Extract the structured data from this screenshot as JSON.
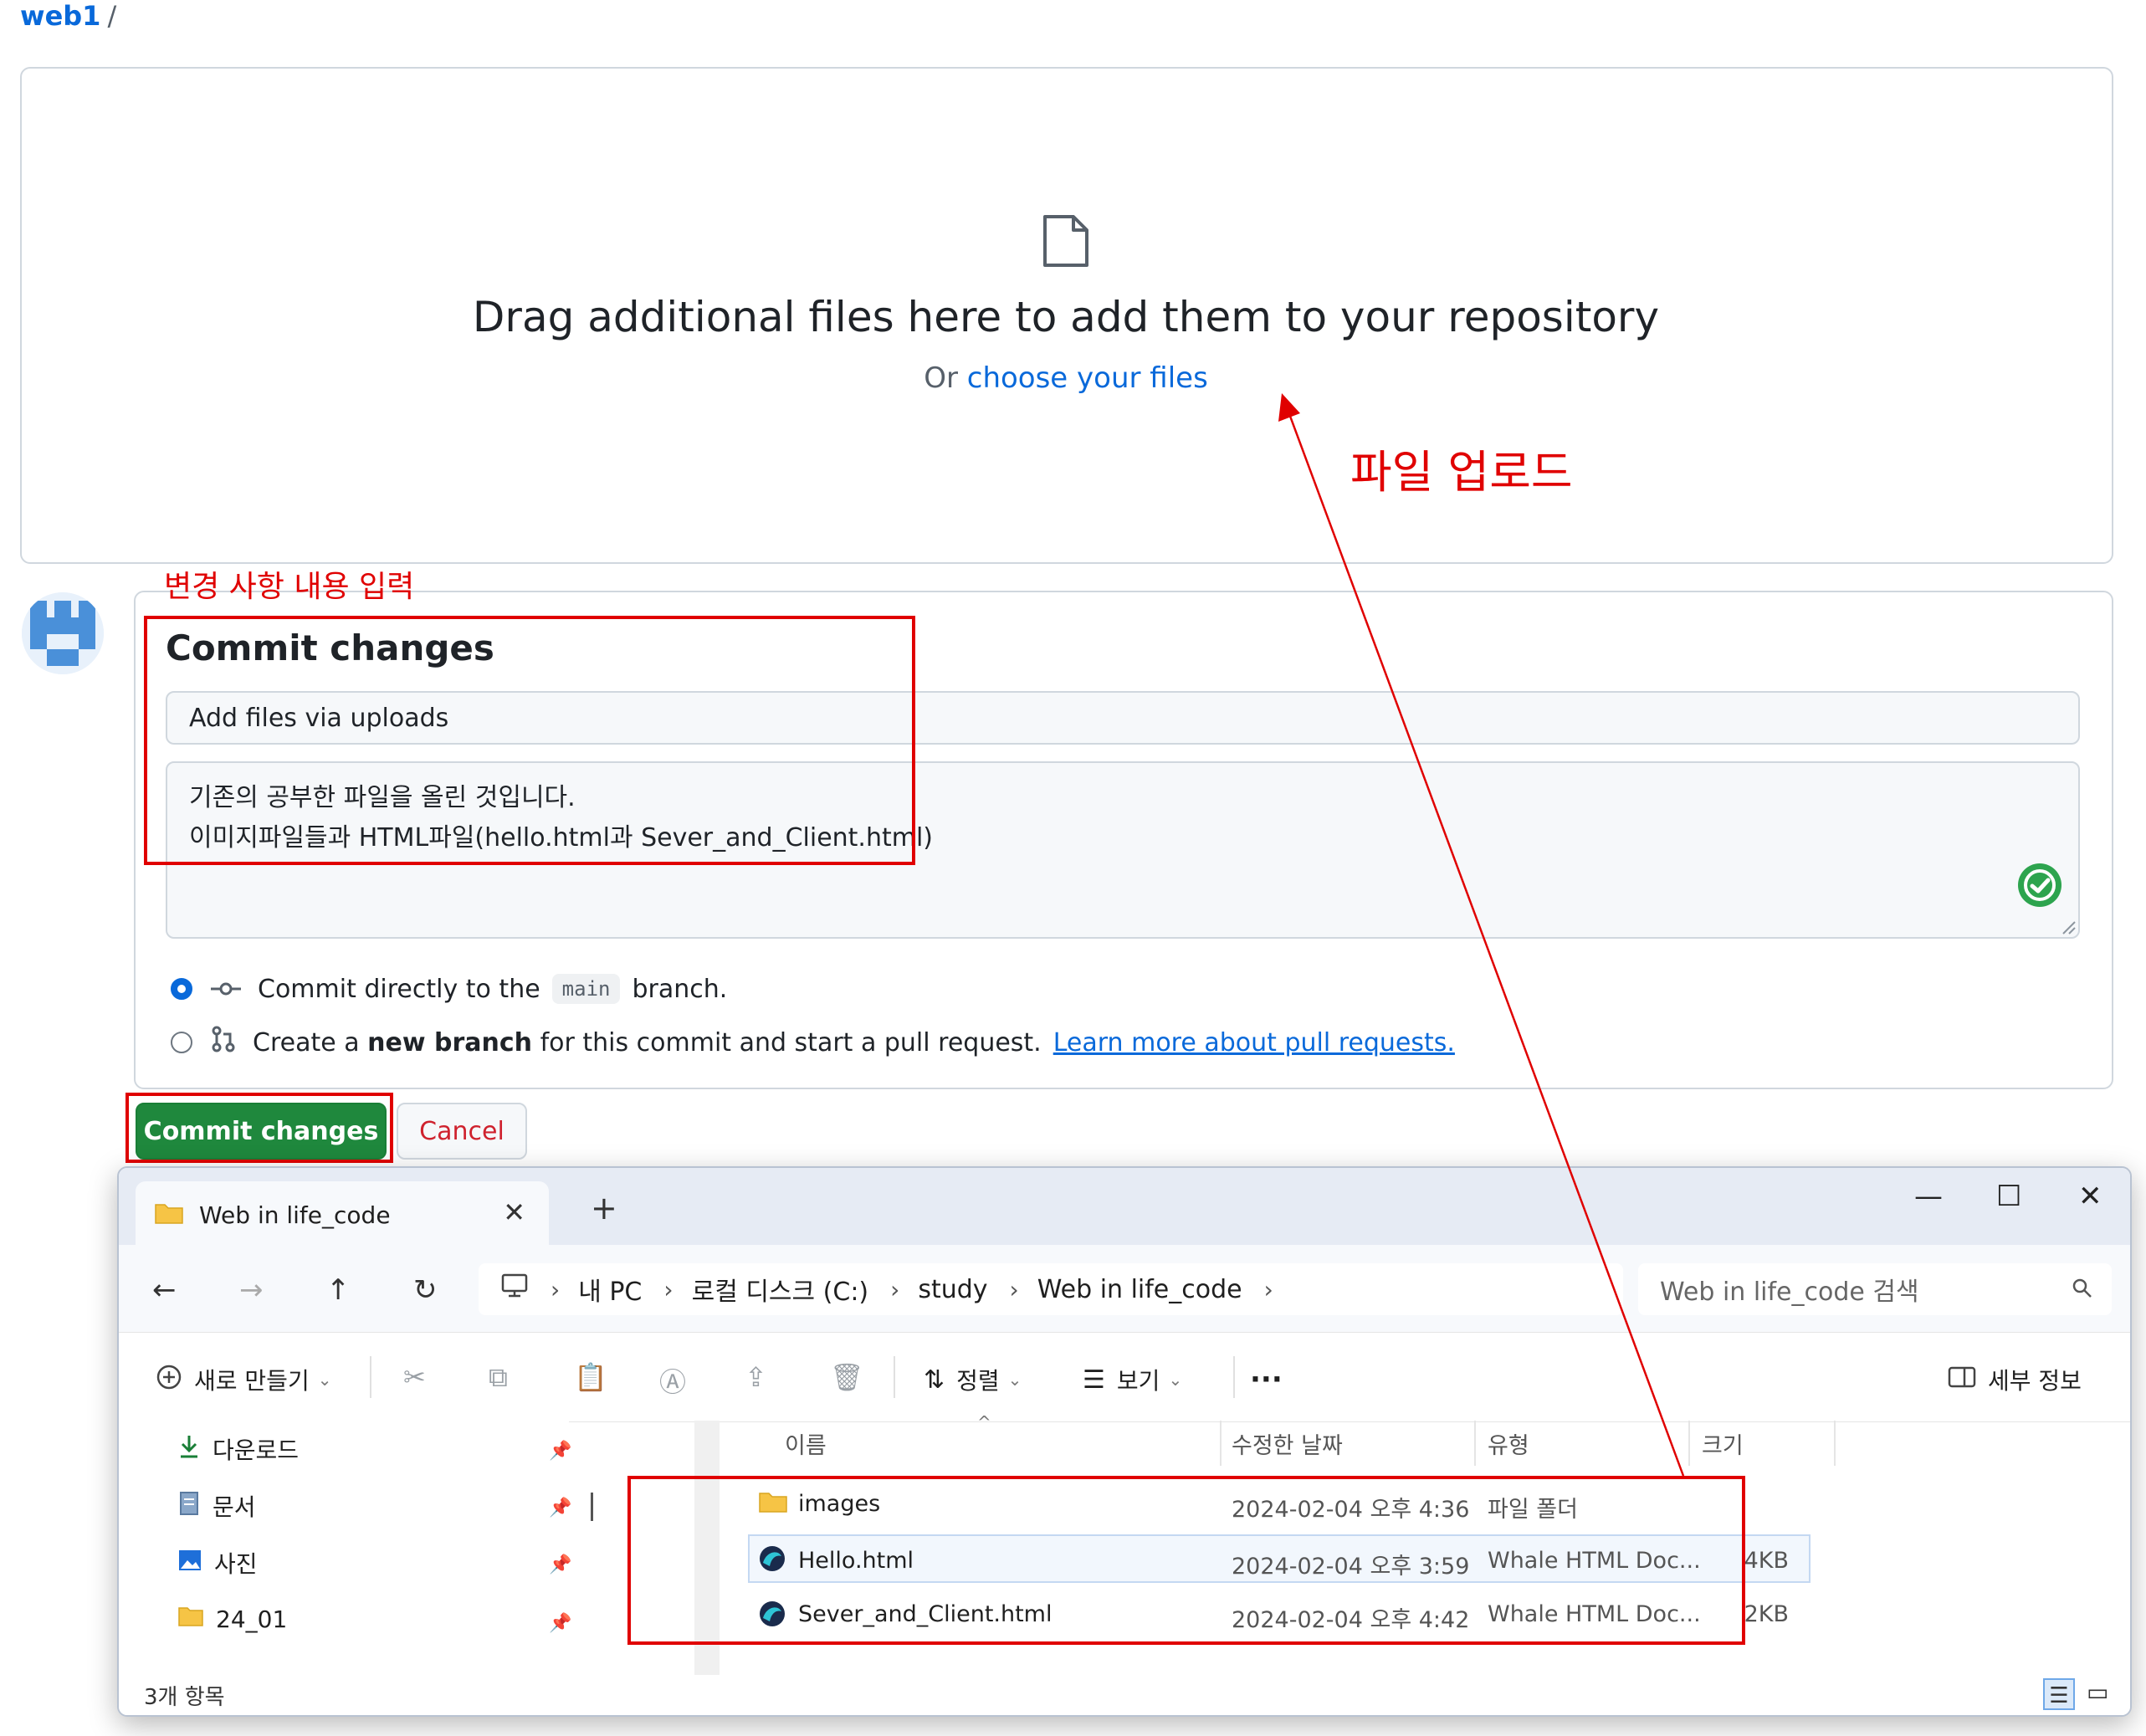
{
  "breadcrumb": {
    "repo": "web1",
    "separator": "/"
  },
  "dropzone": {
    "title": "Drag additional files here to add them to your repository",
    "or": "Or",
    "choose": "choose your files"
  },
  "commit": {
    "heading": "Commit changes",
    "summary_value": "Add files via uploads",
    "description_line1": "기존의 공부한 파일을 올린 것입니다.",
    "description_line2": "이미지파일들과 HTML파일(hello.html과 Sever_and_Client.html)",
    "option1_text_a": "Commit directly to the",
    "option1_branch": "main",
    "option1_text_b": "branch.",
    "option2_text_a": "Create a",
    "option2_bold": "new branch",
    "option2_text_b": "for this commit and start a pull request.",
    "option2_link": "Learn more about pull requests.",
    "commit_button": "Commit changes",
    "cancel_button": "Cancel"
  },
  "annotations": {
    "upload_label": "파일 업로드",
    "commit_label": "변경 사항 내용 입력",
    "color": "#e00000"
  },
  "explorer": {
    "tab_title": "Web in life_code",
    "tab_close": "✕",
    "tab_new": "+",
    "window_controls": {
      "minimize": "—",
      "maximize": "☐",
      "close": "✕"
    },
    "nav": {
      "back": "←",
      "forward": "→",
      "up": "↑",
      "refresh": "↻"
    },
    "address": [
      "내 PC",
      "로컬 디스크 (C:)",
      "study",
      "Web in life_code"
    ],
    "search_placeholder": "Web in life_code 검색",
    "toolbar": {
      "new": "새로 만들기",
      "sort": "정렬",
      "view": "보기",
      "more": "···",
      "details": "세부 정보"
    },
    "sidebar": [
      {
        "label": "다운로드",
        "icon": "download-icon"
      },
      {
        "label": "문서",
        "icon": "document-icon"
      },
      {
        "label": "사진",
        "icon": "picture-icon"
      },
      {
        "label": "24_01",
        "icon": "folder-icon"
      }
    ],
    "columns": {
      "name": "이름",
      "modified": "수정한 날짜",
      "type": "유형",
      "size": "크기"
    },
    "files": [
      {
        "name": "images",
        "modified": "2024-02-04 오후 4:36",
        "type": "파일 폴더",
        "size": "",
        "icon": "folder-icon"
      },
      {
        "name": "Hello.html",
        "modified": "2024-02-04 오후 3:59",
        "type": "Whale HTML Doc...",
        "size": "4KB",
        "icon": "whale-browser-icon"
      },
      {
        "name": "Sever_and_Client.html",
        "modified": "2024-02-04 오후 4:42",
        "type": "Whale HTML Doc...",
        "size": "2KB",
        "icon": "whale-browser-icon"
      }
    ],
    "status": "3개 항목"
  },
  "colors": {
    "link": "#0969da",
    "commit_button": "#1f883d",
    "cancel_text": "#cf222e",
    "folder": "#f6c445"
  }
}
